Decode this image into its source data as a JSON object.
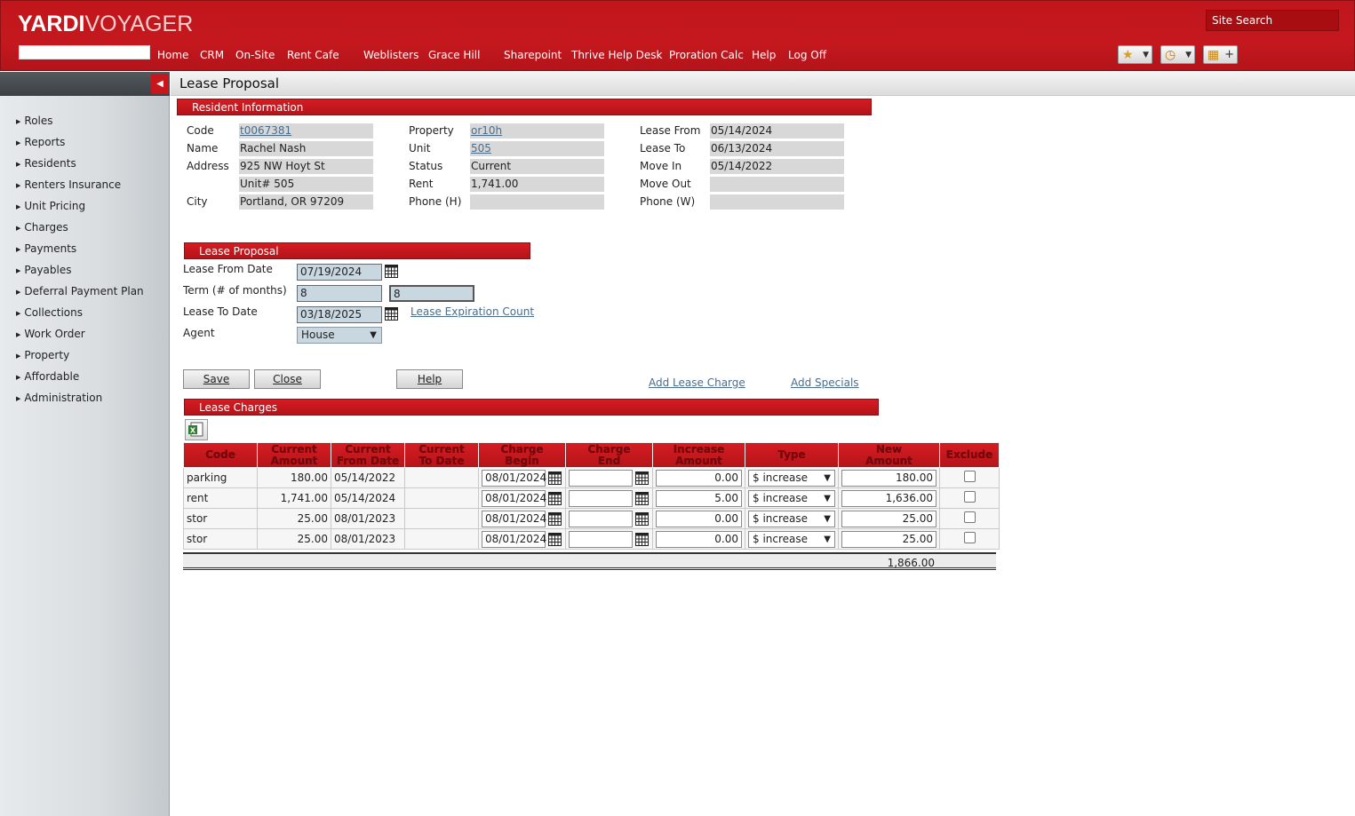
{
  "header": {
    "logo_main": "YARDI",
    "logo_sub": "VOYAGER",
    "site_search": "Site Search",
    "nav": [
      "Home",
      "CRM",
      "On-Site",
      "Rent Cafe",
      "Weblisters",
      "Grace Hill",
      "Sharepoint",
      "Thrive Help Desk",
      "Proration Calc",
      "Help",
      "Log Off"
    ]
  },
  "sidebar": {
    "items": [
      "Roles",
      "Reports",
      "Residents",
      "Renters Insurance",
      "Unit Pricing",
      "Charges",
      "Payments",
      "Payables",
      "Deferral Payment Plan",
      "Collections",
      "Work Order",
      "Property",
      "Affordable",
      "Administration"
    ]
  },
  "page_title": "Lease Proposal",
  "resident_info": {
    "header": "Resident Information",
    "code_label": "Code",
    "code": "t0067381",
    "name_label": "Name",
    "name": "Rachel Nash",
    "address_label": "Address",
    "address1": "925 NW Hoyt St",
    "address2": "Unit# 505",
    "city_label": "City",
    "city": "Portland, OR 97209",
    "property_label": "Property",
    "property": "or10h",
    "unit_label": "Unit",
    "unit": "505",
    "status_label": "Status",
    "status": "Current",
    "rent_label": "Rent",
    "rent": "1,741.00",
    "phone_h_label": "Phone (H)",
    "phone_h": "",
    "lease_from_label": "Lease From",
    "lease_from": "05/14/2024",
    "lease_to_label": "Lease To",
    "lease_to": "06/13/2024",
    "move_in_label": "Move In",
    "move_in": "05/14/2022",
    "move_out_label": "Move Out",
    "move_out": "",
    "phone_w_label": "Phone (W)",
    "phone_w": ""
  },
  "lease_proposal": {
    "header": "Lease Proposal",
    "from_label": "Lease From Date",
    "from_value": "07/19/2024",
    "term_label": "Term (# of months)",
    "term_value": "8",
    "term_value2": "8",
    "to_label": "Lease To Date",
    "to_value": "03/18/2025",
    "expiration_link": "Lease Expiration Count",
    "agent_label": "Agent",
    "agent_value": "House"
  },
  "buttons": {
    "save": "Save",
    "close": "Close",
    "help": "Help",
    "add_lease_charge": "Add Lease Charge",
    "add_specials": "Add Specials"
  },
  "lease_charges": {
    "header": "Lease Charges",
    "columns": [
      [
        "Code",
        ""
      ],
      [
        "Current",
        "Amount"
      ],
      [
        "Current",
        "From Date"
      ],
      [
        "Current",
        "To Date"
      ],
      [
        "Charge",
        "Begin"
      ],
      [
        "Charge",
        "End"
      ],
      [
        "Increase",
        "Amount"
      ],
      [
        "Type",
        ""
      ],
      [
        "New",
        "Amount"
      ],
      [
        "Exclude",
        ""
      ]
    ],
    "rows": [
      {
        "code": "parking",
        "current_amount": "180.00",
        "from_date": "05/14/2022",
        "to_date": "",
        "begin": "08/01/2024",
        "end": "",
        "increase": "0.00",
        "type": "$ increase",
        "new_amount": "180.00"
      },
      {
        "code": "rent",
        "current_amount": "1,741.00",
        "from_date": "05/14/2024",
        "to_date": "",
        "begin": "08/01/2024",
        "end": "",
        "increase": "5.00",
        "type": "$ increase",
        "new_amount": "1,636.00"
      },
      {
        "code": "stor",
        "current_amount": "25.00",
        "from_date": "08/01/2023",
        "to_date": "",
        "begin": "08/01/2024",
        "end": "",
        "increase": "0.00",
        "type": "$ increase",
        "new_amount": "25.00"
      },
      {
        "code": "stor",
        "current_amount": "25.00",
        "from_date": "08/01/2023",
        "to_date": "",
        "begin": "08/01/2024",
        "end": "",
        "increase": "0.00",
        "type": "$ increase",
        "new_amount": "25.00"
      }
    ],
    "total": "1,866.00"
  },
  "colors": {
    "brand_red": "#c4181e",
    "field_gray": "#d8d8d8",
    "input_blue": "#c9d7e1"
  }
}
